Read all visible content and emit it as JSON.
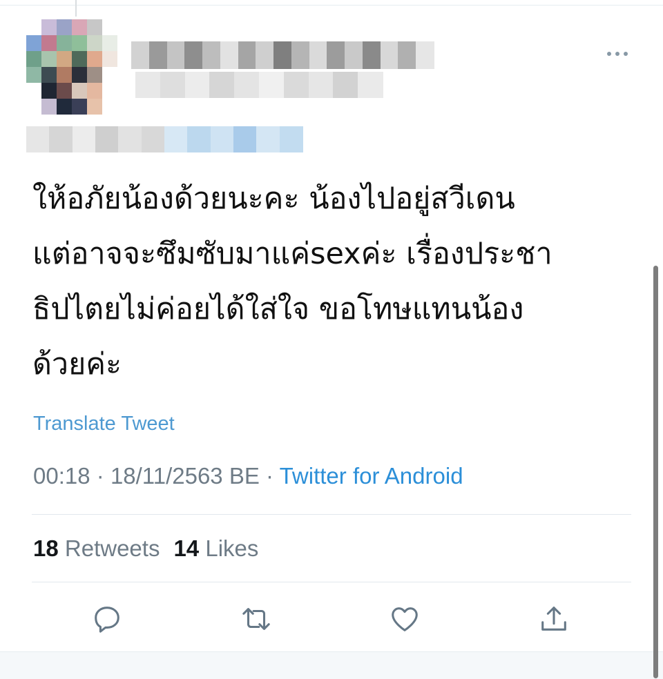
{
  "tweet": {
    "text": "ให้อภัยน้องด้วยนะคะ น้องไปอยู่สวีเดน\nแต่อาจจะซึมซับมาแค่sexค่ะ  เรื่องประชา\nธิปไตยไม่ค่อยได้ใส่ใจ ขอโทษแทนน้อง\nด้วยค่ะ",
    "translate_label": "Translate Tweet",
    "time": "00:18",
    "separator": "·",
    "date": "18/11/2563 BE",
    "source": "Twitter for Android"
  },
  "stats": {
    "retweets_count": "18",
    "retweets_label": "Retweets",
    "likes_count": "14",
    "likes_label": "Likes"
  },
  "icons": {
    "more": "more-icon",
    "reply": "reply-icon",
    "retweet": "retweet-icon",
    "like": "heart-icon",
    "share": "share-icon"
  },
  "colors": {
    "link": "#2c8fd8",
    "translate": "#4d99d1",
    "meta": "#6e7b86",
    "icon": "#657786",
    "divider": "#e1e8ed"
  }
}
